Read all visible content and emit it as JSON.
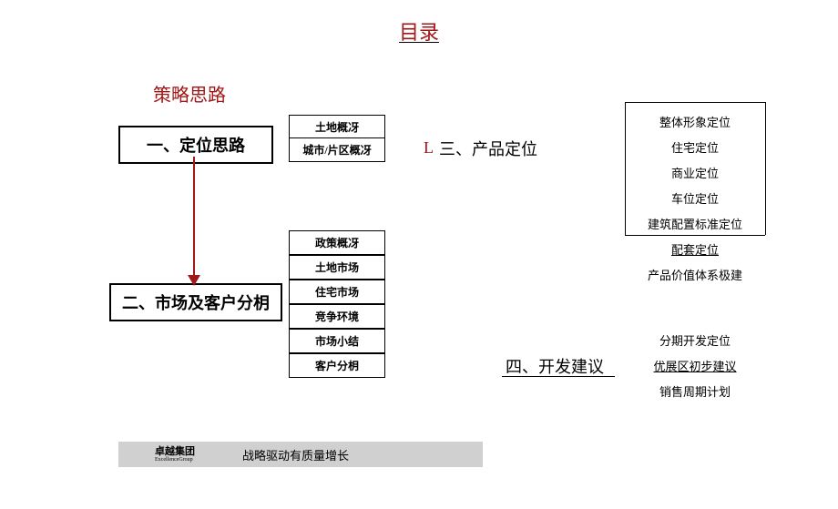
{
  "title": "目录",
  "subtitle": "策略思路",
  "main_boxes": {
    "box1": "一、定位思路",
    "box2": "二、市场及客户分枂"
  },
  "small_boxes": {
    "sb1": "土地概冴",
    "sb2": "城市/片区概冴",
    "sb3": "政策概冴",
    "sb4": "土地市场",
    "sb5": "住宅市场",
    "sb6": "竞争环境",
    "sb7": "市场小结",
    "sb8": "客户分枂"
  },
  "section3_prefix": "L",
  "section3": "三、产品定位",
  "section4": "四、开发建议",
  "right_items": {
    "r1": "整体形象定位",
    "r2": "住宅定位",
    "r3": "商业定位",
    "r4": "车位定位",
    "r5": "建筑配置标准定位",
    "r6": "配套定位",
    "r7": "产品价值体系极建",
    "r8": "分期开发定位",
    "r9": "优展区初步建议",
    "r10": "销售周期计划"
  },
  "footer": {
    "company": "卓越集团",
    "company_en": "ExcellenceGroup",
    "slogan": "战略驱动有质量增长"
  }
}
